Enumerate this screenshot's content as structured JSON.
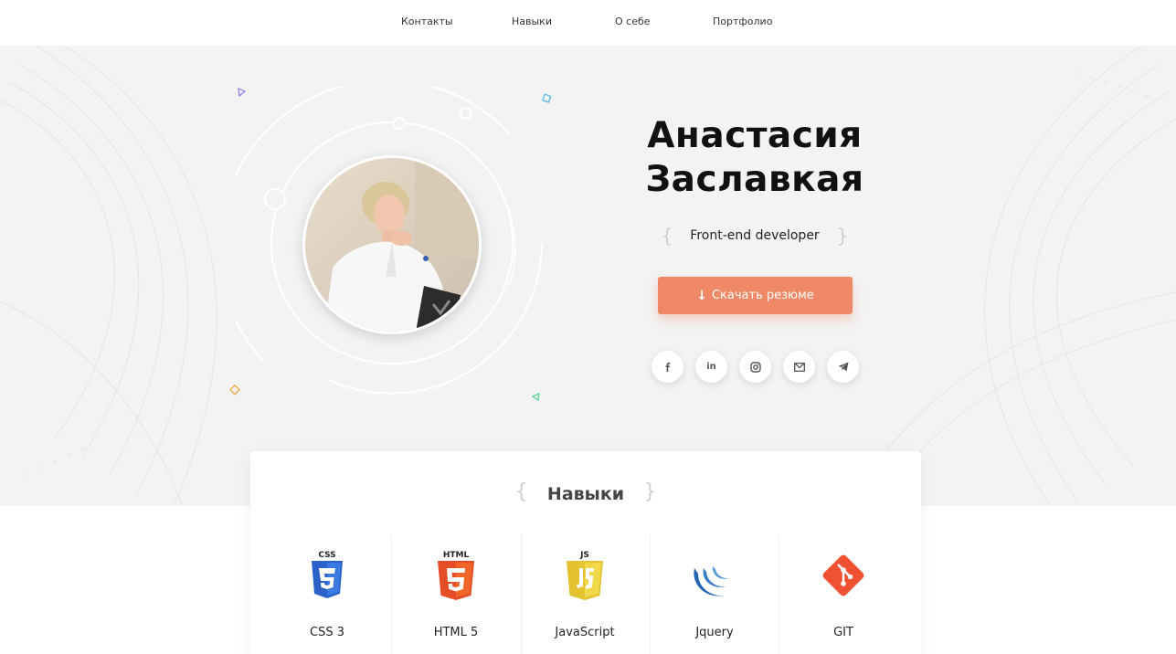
{
  "nav": {
    "items": [
      "Контакты",
      "Навыки",
      "О себе",
      "Портфолио"
    ]
  },
  "hero": {
    "name_line1": "Анастасия",
    "name_line2": "Заславкая",
    "role": "Front-end developer",
    "download_label": "Скачать резюме",
    "socials": [
      "facebook-icon",
      "linkedin-icon",
      "instagram-icon",
      "mail-icon",
      "telegram-icon"
    ]
  },
  "skills": {
    "title": "Навыки",
    "items": [
      {
        "label": "CSS 3",
        "icon": "css3-icon"
      },
      {
        "label": "HTML 5",
        "icon": "html5-icon"
      },
      {
        "label": "JavaScript",
        "icon": "javascript-icon"
      },
      {
        "label": "Jquery",
        "icon": "jquery-icon"
      },
      {
        "label": "GIT",
        "icon": "git-icon"
      }
    ]
  },
  "colors": {
    "accent": "#ee8866",
    "hero_bg": "#f3f3f3"
  }
}
